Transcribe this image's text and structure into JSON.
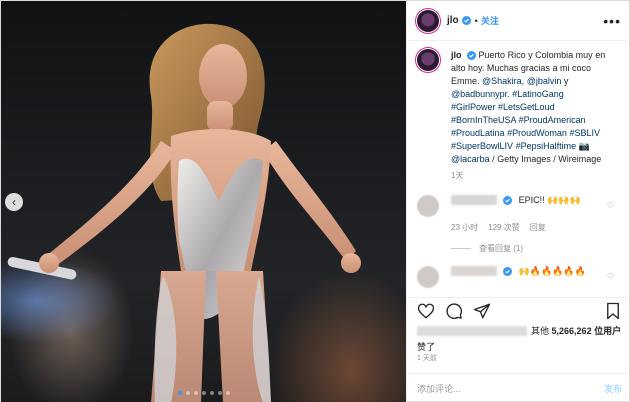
{
  "header": {
    "username": "jlo",
    "separator": "•",
    "follow_label": "关注",
    "more_icon": "more-icon"
  },
  "caption": {
    "username": "jlo",
    "lines": [
      "Puerto Rico y Colombia muy en",
      "alto hoy. Muchas gracias a mi coco",
      "Emme. @Shakira, @jbalvin y",
      "@badbunnypr. #LatinoGang",
      "#GirlPower #LetsGetLoud",
      "#BornInTheUSA #ProudAmerican",
      "#ProudLatina #ProudWoman #SBLIV",
      "#SuperBowlLIV #PepsiHalftime 📷",
      "@lacarba / Getty Images / Wireimage"
    ],
    "age": "1天"
  },
  "comments": [
    {
      "text": "EPIC!! 🙌🙌🙌",
      "time": "23 小时",
      "likes": "129 次赞",
      "reply": "回复",
      "view_replies": "查看回复 (1)"
    },
    {
      "text": "🙌🔥🔥🔥🔥🔥"
    }
  ],
  "likes": {
    "prefix": "其他",
    "count": "5,266,262",
    "suffix": "位用户",
    "liked": "赞了"
  },
  "timestamp": "1 天前",
  "add_comment": {
    "placeholder": "添加评论...",
    "post_label": "发布"
  },
  "carousel": {
    "prev_icon": "‹",
    "dot_count": 7,
    "active_dot": 0
  },
  "colors": {
    "accent": "#3897f0",
    "post_disabled": "#b2dffc",
    "meta": "#8e8e8e"
  }
}
